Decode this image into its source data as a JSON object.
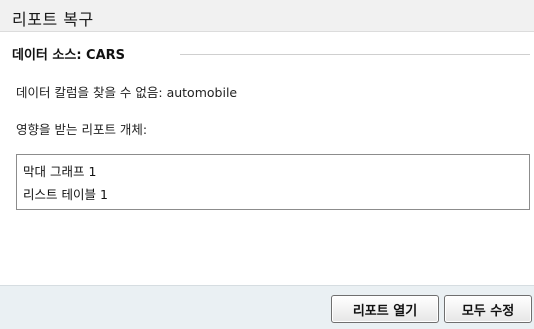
{
  "dialog": {
    "title": "리포트 복구",
    "section_title": "데이터 소스: CARS",
    "message_missing_column": "데이터 칼럼을 찾을 수 없음: automobile",
    "message_affected": "영향을 받는 리포트 개체:",
    "affected_items": [
      {
        "label": "막대 그래프 1"
      },
      {
        "label": "리스트 테이블 1"
      }
    ],
    "buttons": {
      "open_report": "리포트 열기",
      "fix_all": "모두 수정"
    }
  }
}
